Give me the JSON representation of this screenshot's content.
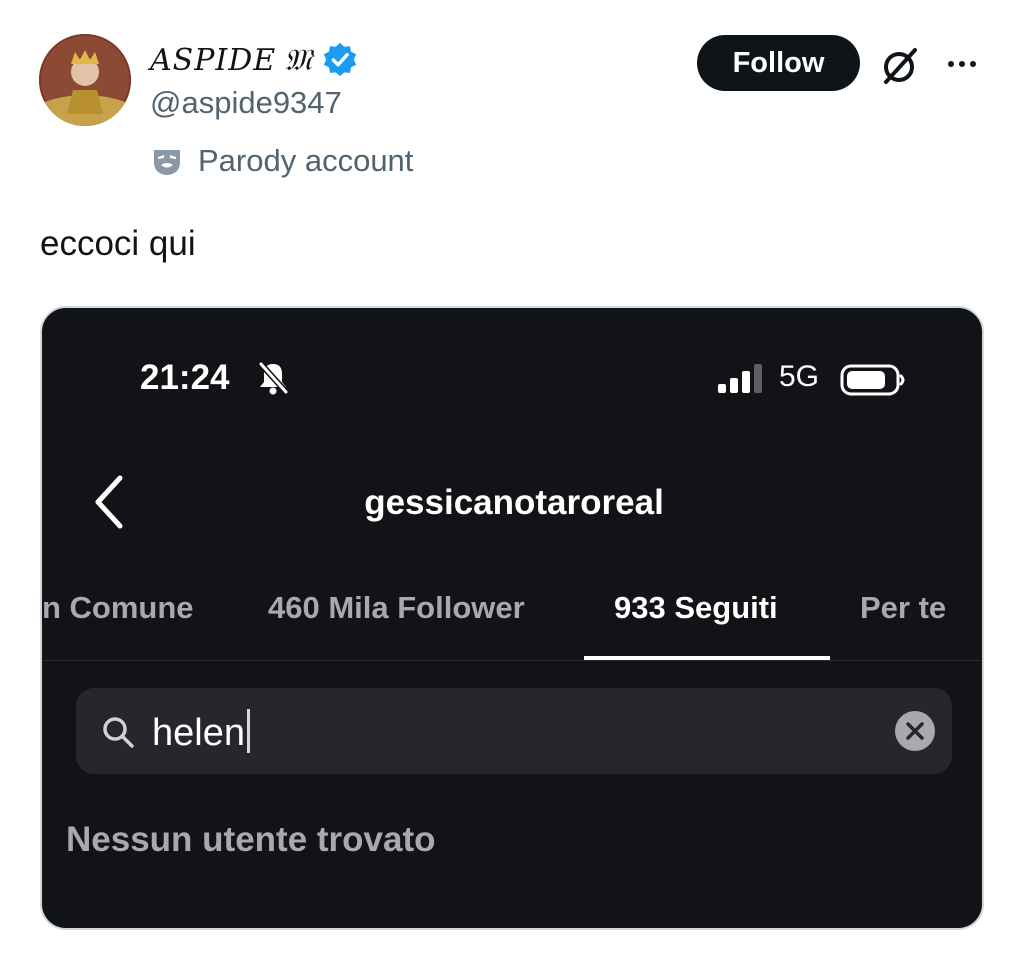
{
  "post": {
    "author": {
      "display_name": "ASPIDE",
      "display_name_suffix": "𝔐",
      "handle": "@aspide9347",
      "label": "Parody account",
      "verified_icon": "verified-badge-icon"
    },
    "actions": {
      "follow_label": "Follow",
      "grok_icon": "grok-icon",
      "more_icon": "more-icon"
    },
    "text": "eccoci qui"
  },
  "screenshot": {
    "status_bar": {
      "time": "21:24",
      "network": "5G",
      "icons": [
        "bell-off-icon",
        "signal-icon",
        "battery-icon"
      ]
    },
    "header": {
      "back_icon": "chevron-left-icon",
      "title": "gessicanotaroreal"
    },
    "tabs": [
      {
        "label": "n Comune",
        "active": false
      },
      {
        "label": "460 Mila Follower",
        "active": false
      },
      {
        "label": "933 Seguiti",
        "active": true
      },
      {
        "label": "Per te",
        "active": false
      }
    ],
    "search": {
      "value": "helen",
      "search_icon": "search-icon",
      "clear_icon": "clear-icon"
    },
    "empty_message": "Nessun utente trovato"
  },
  "colors": {
    "follow_button": "#0f1419",
    "verified_blue": "#1d9bf0",
    "secondary_text": "#536471",
    "media_background": "#121317"
  }
}
